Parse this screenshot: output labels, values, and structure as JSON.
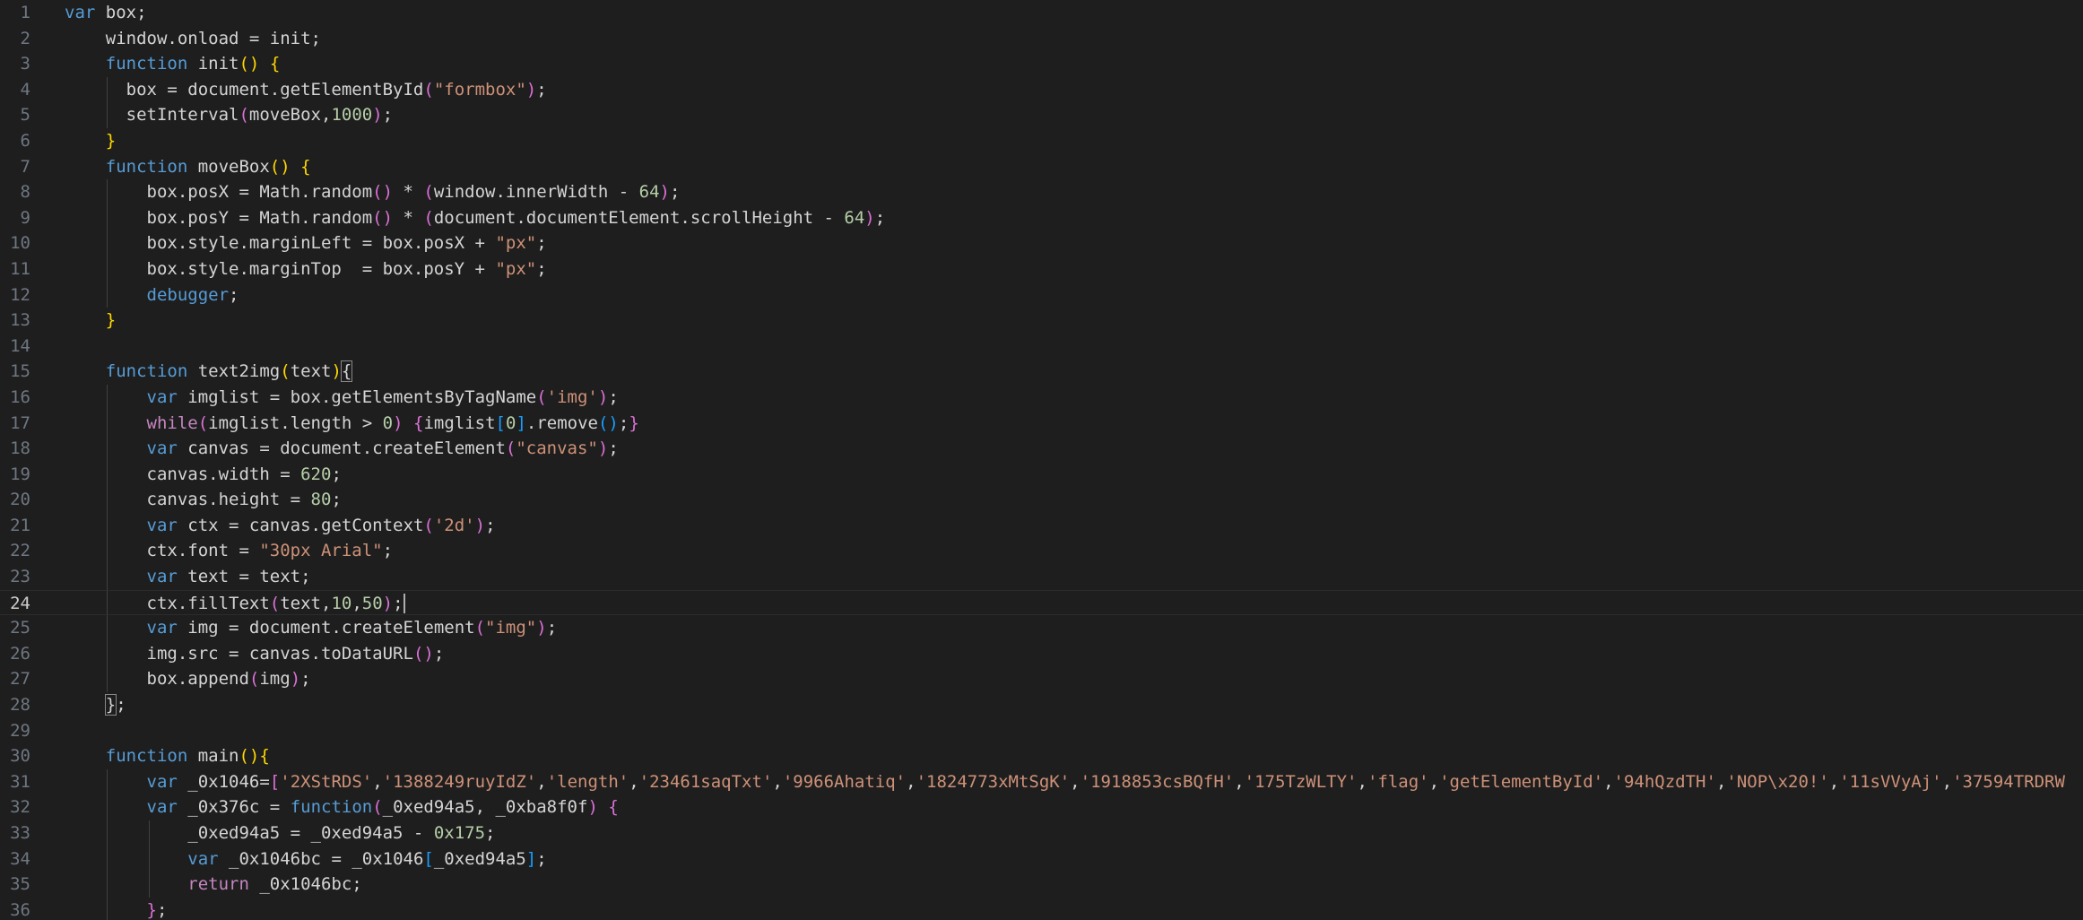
{
  "editor": {
    "current_line": 24,
    "colors": {
      "background": "#1e1e1e",
      "keyword": "#569cd6",
      "control": "#c586c0",
      "variable": "#9cdcfe",
      "function": "#dcdcaa",
      "string": "#ce9178",
      "number": "#b5cea8",
      "bracket_1": "#ffd700",
      "bracket_2": "#da70d6",
      "bracket_3": "#179fff",
      "line_number": "#6e7681"
    },
    "lines": [
      {
        "n": "1",
        "indent": 0,
        "tokens": [
          [
            "kw",
            "var"
          ],
          [
            "pl",
            " box;"
          ]
        ]
      },
      {
        "n": "2",
        "indent": 1,
        "tokens": [
          [
            "pl",
            "    window.onload = init;"
          ]
        ]
      },
      {
        "n": "3",
        "indent": 1,
        "tokens": [
          [
            "pl",
            "    "
          ],
          [
            "kw",
            "function"
          ],
          [
            "pl",
            " init"
          ],
          [
            "br1",
            "()"
          ],
          [
            "pl",
            " "
          ],
          [
            "br1",
            "{"
          ]
        ]
      },
      {
        "n": "4",
        "indent": 2,
        "tokens": [
          [
            "pl",
            "      box = document.getElementById"
          ],
          [
            "br2",
            "("
          ],
          [
            "str",
            "\"formbox\""
          ],
          [
            "br2",
            ")"
          ],
          [
            "pl",
            ";"
          ]
        ]
      },
      {
        "n": "5",
        "indent": 2,
        "tokens": [
          [
            "pl",
            "      setInterval"
          ],
          [
            "br2",
            "("
          ],
          [
            "pl",
            "moveBox,"
          ],
          [
            "num",
            "1000"
          ],
          [
            "br2",
            ")"
          ],
          [
            "pl",
            ";"
          ]
        ]
      },
      {
        "n": "6",
        "indent": 1,
        "tokens": [
          [
            "pl",
            "    "
          ],
          [
            "br1",
            "}"
          ]
        ]
      },
      {
        "n": "7",
        "indent": 1,
        "tokens": [
          [
            "pl",
            "    "
          ],
          [
            "kw",
            "function"
          ],
          [
            "pl",
            " moveBox"
          ],
          [
            "br1",
            "()"
          ],
          [
            "pl",
            " "
          ],
          [
            "br1",
            "{"
          ]
        ]
      },
      {
        "n": "8",
        "indent": 2,
        "tokens": [
          [
            "pl",
            "        box.posX = Math.random"
          ],
          [
            "br2",
            "()"
          ],
          [
            "pl",
            " * "
          ],
          [
            "br2",
            "("
          ],
          [
            "pl",
            "window.innerWidth - "
          ],
          [
            "num",
            "64"
          ],
          [
            "br2",
            ")"
          ],
          [
            "pl",
            ";"
          ]
        ]
      },
      {
        "n": "9",
        "indent": 2,
        "tokens": [
          [
            "pl",
            "        box.posY = Math.random"
          ],
          [
            "br2",
            "()"
          ],
          [
            "pl",
            " * "
          ],
          [
            "br2",
            "("
          ],
          [
            "pl",
            "document.documentElement.scrollHeight - "
          ],
          [
            "num",
            "64"
          ],
          [
            "br2",
            ")"
          ],
          [
            "pl",
            ";"
          ]
        ]
      },
      {
        "n": "10",
        "indent": 2,
        "tokens": [
          [
            "pl",
            "        box.style.marginLeft = box.posX + "
          ],
          [
            "str",
            "\"px\""
          ],
          [
            "pl",
            ";"
          ]
        ]
      },
      {
        "n": "11",
        "indent": 2,
        "tokens": [
          [
            "pl",
            "        box.style.marginTop  = box.posY + "
          ],
          [
            "str",
            "\"px\""
          ],
          [
            "pl",
            ";"
          ]
        ]
      },
      {
        "n": "12",
        "indent": 2,
        "tokens": [
          [
            "pl",
            "        "
          ],
          [
            "kw",
            "debugger"
          ],
          [
            "pl",
            ";"
          ]
        ]
      },
      {
        "n": "13",
        "indent": 1,
        "tokens": [
          [
            "pl",
            "    "
          ],
          [
            "br1",
            "}"
          ]
        ]
      },
      {
        "n": "14",
        "indent": 1,
        "tokens": []
      },
      {
        "n": "15",
        "indent": 1,
        "tokens": [
          [
            "pl",
            "    "
          ],
          [
            "kw",
            "function"
          ],
          [
            "pl",
            " text2img"
          ],
          [
            "br1",
            "("
          ],
          [
            "pl",
            "text"
          ],
          [
            "br1",
            ")"
          ],
          [
            "bm",
            "{"
          ]
        ]
      },
      {
        "n": "16",
        "indent": 2,
        "tokens": [
          [
            "pl",
            "        "
          ],
          [
            "kw",
            "var"
          ],
          [
            "pl",
            " imglist = box.getElementsByTagName"
          ],
          [
            "br2",
            "("
          ],
          [
            "str",
            "'img'"
          ],
          [
            "br2",
            ")"
          ],
          [
            "pl",
            ";"
          ]
        ]
      },
      {
        "n": "17",
        "indent": 2,
        "tokens": [
          [
            "pl",
            "        "
          ],
          [
            "ctl",
            "while"
          ],
          [
            "br2",
            "("
          ],
          [
            "pl",
            "imglist.length > "
          ],
          [
            "num",
            "0"
          ],
          [
            "br2",
            ")"
          ],
          [
            "pl",
            " "
          ],
          [
            "br2",
            "{"
          ],
          [
            "pl",
            "imglist"
          ],
          [
            "br3",
            "["
          ],
          [
            "num",
            "0"
          ],
          [
            "br3",
            "]"
          ],
          [
            "pl",
            ".remove"
          ],
          [
            "br3",
            "()"
          ],
          [
            "pl",
            ";"
          ],
          [
            "br2",
            "}"
          ]
        ]
      },
      {
        "n": "18",
        "indent": 2,
        "tokens": [
          [
            "pl",
            "        "
          ],
          [
            "kw",
            "var"
          ],
          [
            "pl",
            " canvas = document.createElement"
          ],
          [
            "br2",
            "("
          ],
          [
            "str",
            "\"canvas\""
          ],
          [
            "br2",
            ")"
          ],
          [
            "pl",
            ";"
          ]
        ]
      },
      {
        "n": "19",
        "indent": 2,
        "tokens": [
          [
            "pl",
            "        canvas.width = "
          ],
          [
            "num",
            "620"
          ],
          [
            "pl",
            ";"
          ]
        ]
      },
      {
        "n": "20",
        "indent": 2,
        "tokens": [
          [
            "pl",
            "        canvas.height = "
          ],
          [
            "num",
            "80"
          ],
          [
            "pl",
            ";"
          ]
        ]
      },
      {
        "n": "21",
        "indent": 2,
        "tokens": [
          [
            "pl",
            "        "
          ],
          [
            "kw",
            "var"
          ],
          [
            "pl",
            " ctx = canvas.getContext"
          ],
          [
            "br2",
            "("
          ],
          [
            "str",
            "'2d'"
          ],
          [
            "br2",
            ")"
          ],
          [
            "pl",
            ";"
          ]
        ]
      },
      {
        "n": "22",
        "indent": 2,
        "tokens": [
          [
            "pl",
            "        ctx.font = "
          ],
          [
            "str",
            "\"30px Arial\""
          ],
          [
            "pl",
            ";"
          ]
        ]
      },
      {
        "n": "23",
        "indent": 2,
        "tokens": [
          [
            "pl",
            "        "
          ],
          [
            "kw",
            "var"
          ],
          [
            "pl",
            " text = text;"
          ]
        ]
      },
      {
        "n": "24",
        "indent": 2,
        "tokens": [
          [
            "pl",
            "        ctx.fillText"
          ],
          [
            "br2",
            "("
          ],
          [
            "pl",
            "text,"
          ],
          [
            "num",
            "10"
          ],
          [
            "pl",
            ","
          ],
          [
            "num",
            "50"
          ],
          [
            "br2",
            ")"
          ],
          [
            "pl",
            ";"
          ]
        ],
        "cursor": true
      },
      {
        "n": "25",
        "indent": 2,
        "tokens": [
          [
            "pl",
            "        "
          ],
          [
            "kw",
            "var"
          ],
          [
            "pl",
            " img = document.createElement"
          ],
          [
            "br2",
            "("
          ],
          [
            "str",
            "\"img\""
          ],
          [
            "br2",
            ")"
          ],
          [
            "pl",
            ";"
          ]
        ]
      },
      {
        "n": "26",
        "indent": 2,
        "tokens": [
          [
            "pl",
            "        img.src = canvas.toDataURL"
          ],
          [
            "br2",
            "()"
          ],
          [
            "pl",
            ";"
          ]
        ]
      },
      {
        "n": "27",
        "indent": 2,
        "tokens": [
          [
            "pl",
            "        box.append"
          ],
          [
            "br2",
            "("
          ],
          [
            "pl",
            "img"
          ],
          [
            "br2",
            ")"
          ],
          [
            "pl",
            ";"
          ]
        ]
      },
      {
        "n": "28",
        "indent": 1,
        "tokens": [
          [
            "pl",
            "    "
          ],
          [
            "bm",
            "}"
          ],
          [
            "pl",
            ";"
          ]
        ]
      },
      {
        "n": "29",
        "indent": 1,
        "tokens": []
      },
      {
        "n": "30",
        "indent": 1,
        "tokens": [
          [
            "pl",
            "    "
          ],
          [
            "kw",
            "function"
          ],
          [
            "pl",
            " main"
          ],
          [
            "br1",
            "()"
          ],
          [
            "br1",
            "{"
          ]
        ]
      },
      {
        "n": "31",
        "indent": 2,
        "tokens": [
          [
            "pl",
            "        "
          ],
          [
            "kw",
            "var"
          ],
          [
            "pl",
            " _0x1046="
          ],
          [
            "br2",
            "["
          ],
          [
            "str",
            "'2XStRDS'"
          ],
          [
            "pl",
            ","
          ],
          [
            "str",
            "'1388249ruyIdZ'"
          ],
          [
            "pl",
            ","
          ],
          [
            "str",
            "'length'"
          ],
          [
            "pl",
            ","
          ],
          [
            "str",
            "'23461saqTxt'"
          ],
          [
            "pl",
            ","
          ],
          [
            "str",
            "'9966Ahatiq'"
          ],
          [
            "pl",
            ","
          ],
          [
            "str",
            "'1824773xMtSgK'"
          ],
          [
            "pl",
            ","
          ],
          [
            "str",
            "'1918853csBQfH'"
          ],
          [
            "pl",
            ","
          ],
          [
            "str",
            "'175TzWLTY'"
          ],
          [
            "pl",
            ","
          ],
          [
            "str",
            "'flag'"
          ],
          [
            "pl",
            ","
          ],
          [
            "str",
            "'getElementById'"
          ],
          [
            "pl",
            ","
          ],
          [
            "str",
            "'94hQzdTH'"
          ],
          [
            "pl",
            ","
          ],
          [
            "str",
            "'NOP\\x20!'"
          ],
          [
            "pl",
            ","
          ],
          [
            "str",
            "'11sVVyAj'"
          ],
          [
            "pl",
            ","
          ],
          [
            "str",
            "'37594TRDRW"
          ]
        ]
      },
      {
        "n": "32",
        "indent": 2,
        "tokens": [
          [
            "pl",
            "        "
          ],
          [
            "kw",
            "var"
          ],
          [
            "pl",
            " _0x376c = "
          ],
          [
            "kw",
            "function"
          ],
          [
            "br2",
            "("
          ],
          [
            "pl",
            "_0xed94a5, _0xba8f0f"
          ],
          [
            "br2",
            ")"
          ],
          [
            "pl",
            " "
          ],
          [
            "br2",
            "{"
          ]
        ]
      },
      {
        "n": "33",
        "indent": 3,
        "tokens": [
          [
            "pl",
            "            _0xed94a5 = _0xed94a5 - "
          ],
          [
            "num",
            "0x175"
          ],
          [
            "pl",
            ";"
          ]
        ]
      },
      {
        "n": "34",
        "indent": 3,
        "tokens": [
          [
            "pl",
            "            "
          ],
          [
            "kw",
            "var"
          ],
          [
            "pl",
            " _0x1046bc = _0x1046"
          ],
          [
            "br3",
            "["
          ],
          [
            "pl",
            "_0xed94a5"
          ],
          [
            "br3",
            "]"
          ],
          [
            "pl",
            ";"
          ]
        ]
      },
      {
        "n": "35",
        "indent": 3,
        "tokens": [
          [
            "pl",
            "            "
          ],
          [
            "ctl",
            "return"
          ],
          [
            "pl",
            " _0x1046bc;"
          ]
        ]
      },
      {
        "n": "36",
        "indent": 2,
        "tokens": [
          [
            "pl",
            "        "
          ],
          [
            "br2",
            "}"
          ],
          [
            "pl",
            ";"
          ]
        ]
      }
    ]
  }
}
